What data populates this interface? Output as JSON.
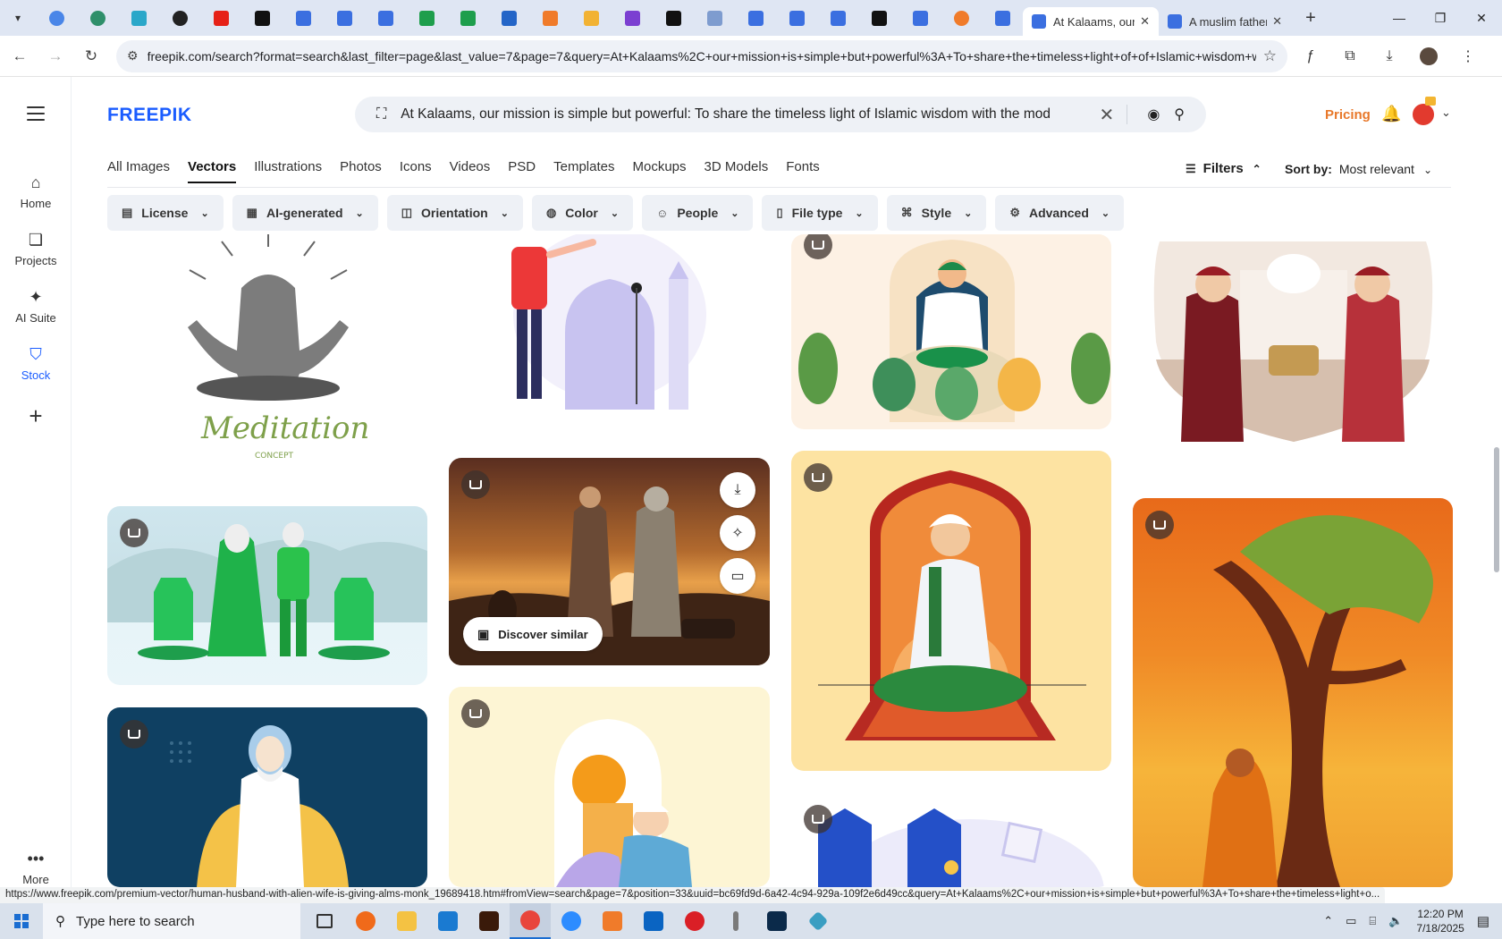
{
  "browser": {
    "tabs": [
      {
        "title": "At Kalaams, our mission is simple but powerful",
        "active": true
      },
      {
        "title": "A muslim father",
        "active": false
      }
    ],
    "new_tab_label": "+",
    "url": "freepik.com/search?format=search&last_filter=page&last_value=7&page=7&query=At+Kalaams%2C+our+mission+is+simple+but+powerful%3A+To+share+the+timeless+light+of+of+Islamic+wisdom+wit...",
    "status_url": "https://www.freepik.com/premium-vector/human-husband-with-alien-wife-is-giving-alms-monk_19689418.htm#fromView=search&page=7&position=33&uuid=bc69fd9d-6a42-4c94-929a-109f2e6d49cc&query=At+Kalaams%2C+our+mission+is+simple+but+powerful%3A+To+share+the+timeless+light+o..."
  },
  "rail": {
    "items": [
      {
        "label": "Home",
        "icon": "home-icon"
      },
      {
        "label": "Projects",
        "icon": "projects-icon"
      },
      {
        "label": "AI Suite",
        "icon": "sparkle-icon"
      },
      {
        "label": "Stock",
        "icon": "stock-icon"
      }
    ],
    "more_label": "More"
  },
  "header": {
    "logo": "FREEPIK",
    "search_query": "At Kalaams, our mission is simple but powerful: To share the timeless light of Islamic wisdom with the mod",
    "pricing_label": "Pricing"
  },
  "categories": [
    "All Images",
    "Vectors",
    "Illustrations",
    "Photos",
    "Icons",
    "Videos",
    "PSD",
    "Templates",
    "Mockups",
    "3D Models",
    "Fonts"
  ],
  "active_category": "Vectors",
  "filters_label": "Filters",
  "sort": {
    "label": "Sort by:",
    "value": "Most relevant"
  },
  "filter_chips": [
    "License",
    "AI-generated",
    "Orientation",
    "Color",
    "People",
    "File type",
    "Style",
    "Advanced"
  ],
  "grid": {
    "meditation_text": "Meditation",
    "meditation_sub": "CONCEPT",
    "discover_label": "Discover similar"
  },
  "taskbar": {
    "search_placeholder": "Type here to search",
    "time": "12:20 PM",
    "date": "7/18/2025"
  },
  "colors": {
    "brand": "#1a5cff",
    "pricing": "#e8782a"
  }
}
